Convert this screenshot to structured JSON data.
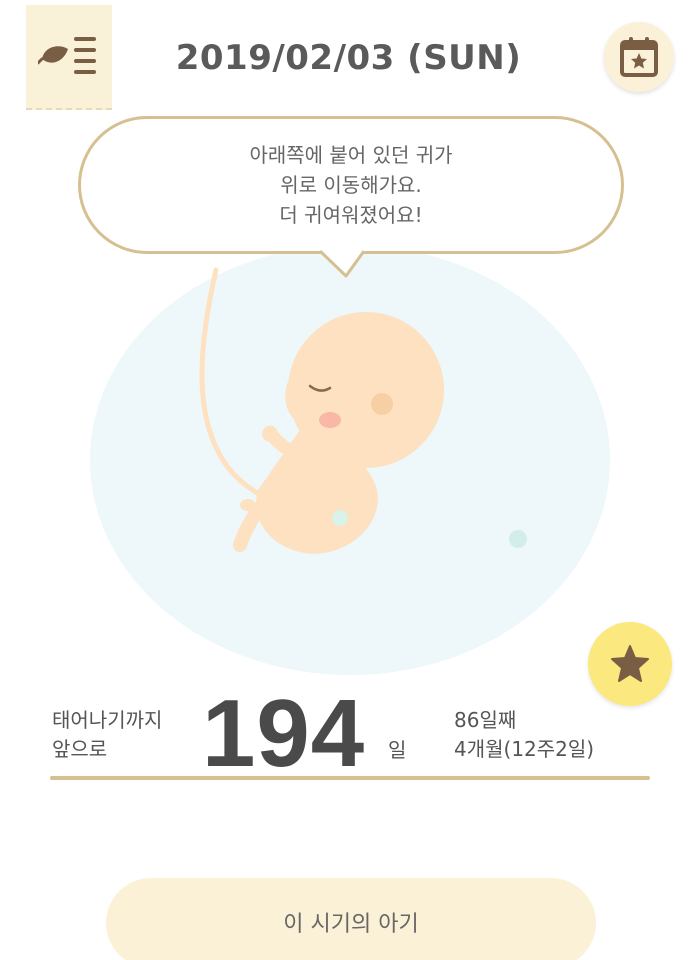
{
  "header": {
    "date": "2019/02/03 (SUN)",
    "menu_icon": "leaf-menu-icon",
    "calendar_icon": "calendar-star-icon"
  },
  "bubble": {
    "lines": [
      "아래쪽에 붙어 있던 귀가",
      "위로 이동해가요.",
      "더 귀여워졌어요!"
    ]
  },
  "countdown": {
    "label_line1": "태어나기까지",
    "label_line2": "앞으로",
    "days": "194",
    "unit": "일",
    "day_count": "86일째",
    "month_week": "4개월(12주2일)"
  },
  "bottom": {
    "button_label": "이 시기의 아기"
  },
  "colors": {
    "accent": "#d6c092",
    "tab_bg": "#faf1d9",
    "star_bg": "#fbe97f",
    "icon_brown": "#7a5e44",
    "womb_bg": "#eef7f9",
    "fetus_skin": "#fde1c0"
  }
}
